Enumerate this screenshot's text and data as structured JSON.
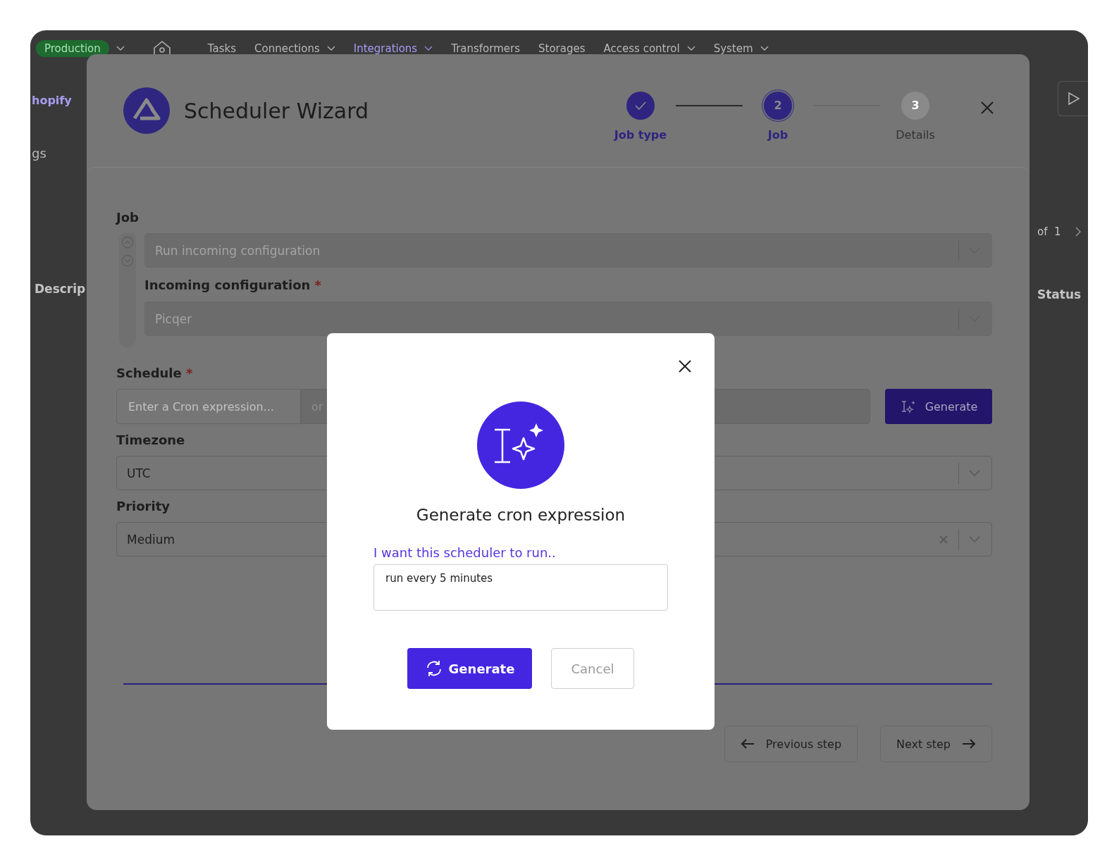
{
  "app_nav": {
    "environment": "Production",
    "items": [
      {
        "label": "Tasks",
        "selected": false,
        "dropdown": false
      },
      {
        "label": "Connections",
        "selected": false,
        "dropdown": true
      },
      {
        "label": "Integrations",
        "selected": true,
        "dropdown": true
      },
      {
        "label": "Transformers",
        "selected": false,
        "dropdown": false
      },
      {
        "label": "Storages",
        "selected": false,
        "dropdown": false
      },
      {
        "label": "Access control",
        "selected": false,
        "dropdown": true
      },
      {
        "label": "System",
        "selected": false,
        "dropdown": true
      }
    ]
  },
  "background": {
    "left_texts": [
      {
        "text": "hopify",
        "kind": "link"
      },
      {
        "text": "gs",
        "kind": "tab"
      },
      {
        "text": "Descrip",
        "kind": "header"
      }
    ],
    "pagination": "of  1",
    "column": "Status"
  },
  "wizard": {
    "title": "Scheduler Wizard",
    "steps": [
      {
        "label": "Job type",
        "done": true,
        "selected": false
      },
      {
        "number": "2",
        "label": "Job",
        "done": false,
        "selected": true
      },
      {
        "number": "3",
        "label": "Details",
        "done": false,
        "selected": false
      }
    ],
    "job": {
      "label": "Job",
      "value": "Run incoming configuration",
      "disabled": true
    },
    "incoming": {
      "label": "Incoming configuration",
      "required_mark": "*",
      "value": "Picqer",
      "disabled": true
    },
    "schedule": {
      "label": "Schedule",
      "required_mark": "*",
      "placeholder": "Enter a Cron expression...",
      "separator": "or",
      "button": "Generate"
    },
    "timezone": {
      "label": "Timezone",
      "value": "UTC"
    },
    "priority": {
      "label": "Priority",
      "value": "Medium",
      "clearable": true
    },
    "previous": "Previous step",
    "next": "Next step"
  },
  "dialog": {
    "title": "Generate cron expression",
    "label": "I want this scheduler to run..",
    "value": "run every 5 minutes",
    "generate": "Generate",
    "cancel": "Cancel"
  }
}
